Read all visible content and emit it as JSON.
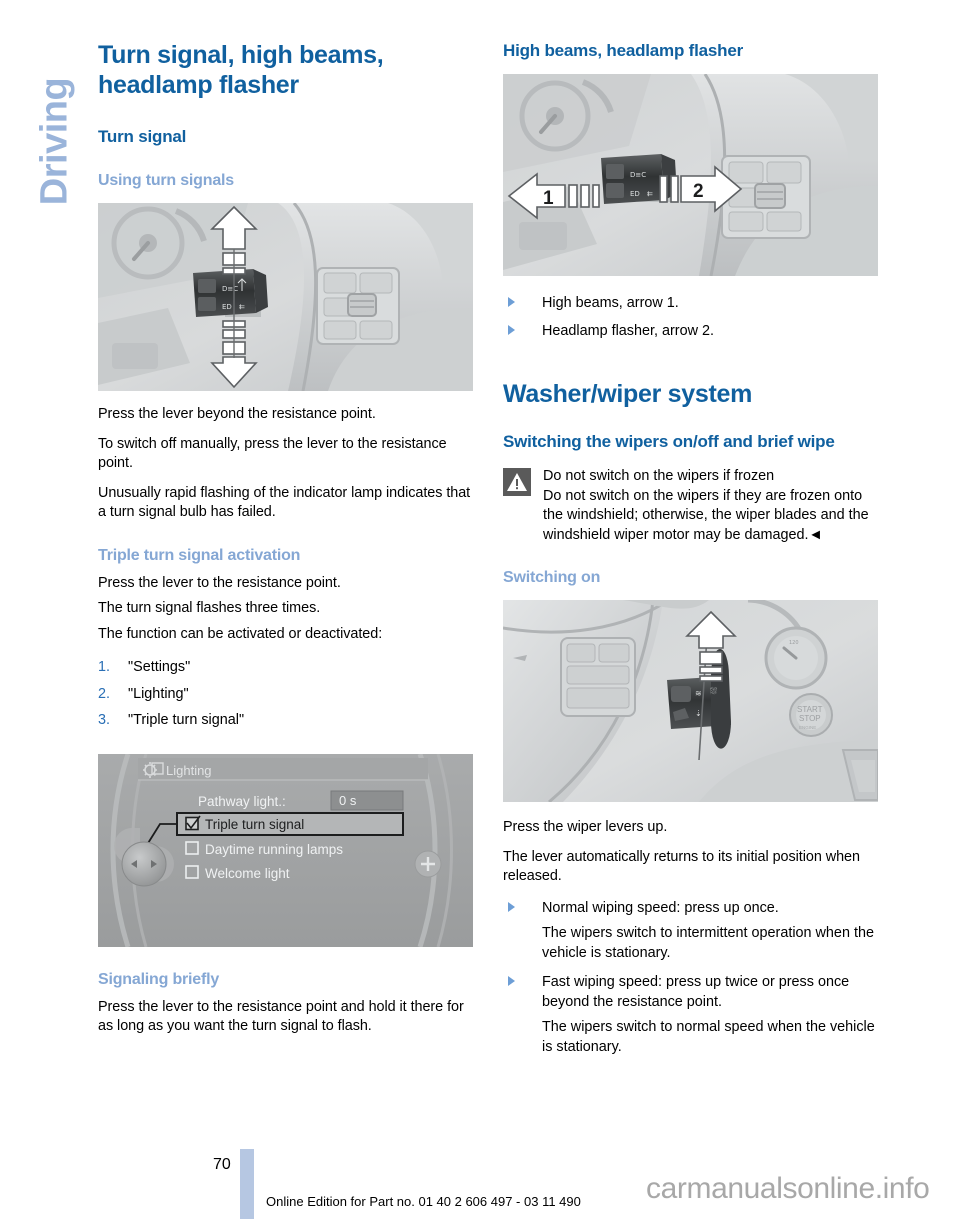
{
  "chapter": {
    "label": "Driving"
  },
  "left": {
    "title": "Turn signal, high beams, headlamp flasher",
    "section_turn_signal": "Turn signal",
    "subsection_using": "Using turn signals",
    "figure_turn_signal_alt": "steering-column-turn-signal-lever-photo",
    "p1": "Press the lever beyond the resistance point.",
    "p2": "To switch off manually, press the lever to the resistance point.",
    "p3": "Unusually rapid flashing of the indicator lamp indicates that a turn signal bulb has failed.",
    "subsection_triple": "Triple turn signal activation",
    "p4": "Press the lever to the resistance point.",
    "p5": "The turn signal flashes three times.",
    "p6": "The function can be activated or deactivated:",
    "steps": [
      {
        "num": "1.",
        "text": "\"Settings\""
      },
      {
        "num": "2.",
        "text": "\"Lighting\""
      },
      {
        "num": "3.",
        "text": "\"Triple turn signal\""
      }
    ],
    "idrive": {
      "header": "Lighting",
      "header_icon": "gear-icon",
      "row_label": "Pathway light.:",
      "row_value": "0 s",
      "options": [
        {
          "label": "Triple turn signal",
          "checked": true,
          "highlighted": true
        },
        {
          "label": "Daytime running lamps",
          "checked": false,
          "highlighted": false
        },
        {
          "label": "Welcome light",
          "checked": false,
          "highlighted": false
        }
      ]
    },
    "subsection_signaling": "Signaling briefly",
    "p7": "Press the lever to the resistance point and hold it there for as long as you want the turn signal to flash."
  },
  "right": {
    "section_high_beams": "High beams, headlamp flasher",
    "figure_high_beams_alt": "high-beams-lever-photo",
    "figure_high_beams_callouts": [
      "1",
      "2"
    ],
    "bullets_high_beams": [
      "High beams, arrow 1.",
      "Headlamp flasher, arrow 2."
    ],
    "title_washer": "Washer/wiper system",
    "subsection_switching": "Switching the wipers on/off and brief wipe",
    "warning": {
      "icon": "warning-triangle-icon",
      "heading": "Do not switch on the wipers if frozen",
      "body": "Do not switch on the wipers if they are frozen onto the windshield; otherwise, the wiper blades and the windshield wiper motor may be damaged.◄"
    },
    "subsection_switching_on": "Switching on",
    "figure_wiper_alt": "wiper-lever-photo",
    "p1": "Press the wiper levers up.",
    "p2": "The lever automatically returns to its initial position when released.",
    "bullets_wiper": [
      {
        "text": "Normal wiping speed: press up once.",
        "cont": "The wipers switch to intermittent operation when the vehicle is stationary."
      },
      {
        "text": "Fast wiping speed: press up twice or press once beyond the resistance point.",
        "cont": "The wipers switch to normal speed when the vehicle is stationary."
      }
    ]
  },
  "footer": {
    "page_number": "70",
    "edition": "Online Edition for Part no. 01 40 2 606 497 - 03 11 490",
    "watermark": "carmanualsonline.info"
  },
  "colors": {
    "heading_dark_blue": "#10609f",
    "heading_light_blue": "#85a7d4",
    "chapter_tab_blue": "#9ab4da",
    "footer_bar": "#b6c7e2",
    "number_blue": "#2a6fb5"
  }
}
